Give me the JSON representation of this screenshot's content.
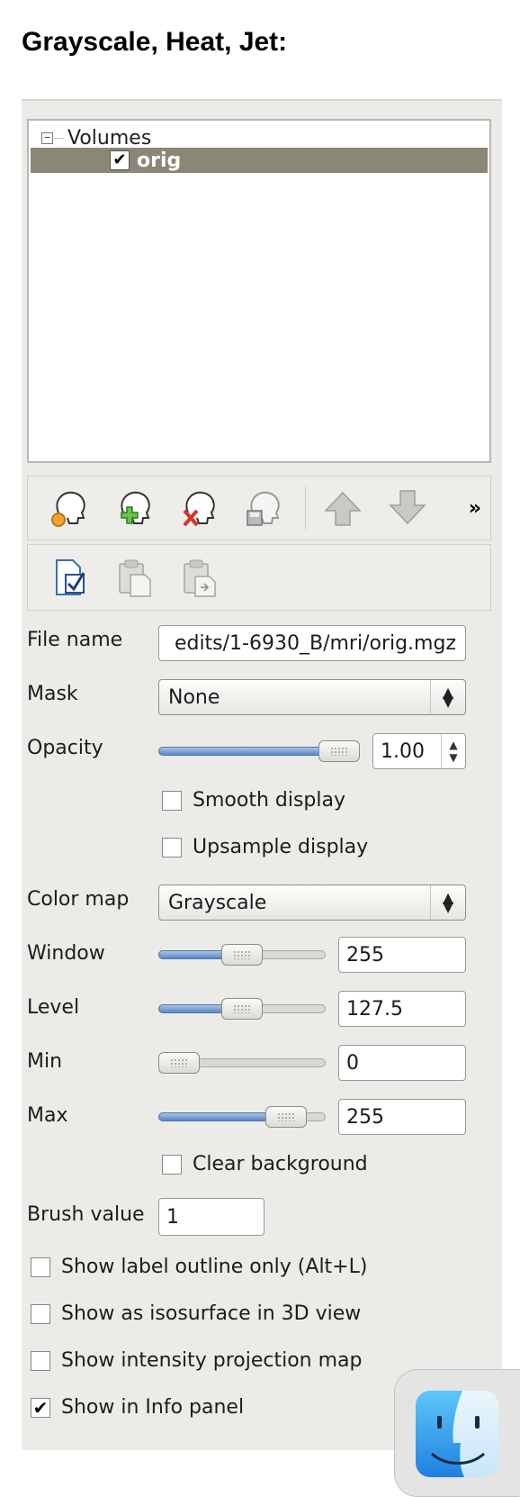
{
  "heading": "Grayscale, Heat, Jet:",
  "tree": {
    "root_label": "Volumes",
    "expander": "−",
    "items": [
      {
        "label": "orig",
        "checked": true
      }
    ]
  },
  "toolbar": {
    "row1": [
      "load-volume-icon",
      "new-volume-icon",
      "close-volume-icon",
      "save-volume-icon",
      "move-up-icon",
      "move-down-icon"
    ],
    "overflow_label": "»",
    "row2": [
      "select-all-icon",
      "copy-settings-icon",
      "paste-settings-icon"
    ]
  },
  "file_name": {
    "label": "File name",
    "value": "edits/1-6930_B/mri/orig.mgz"
  },
  "mask": {
    "label": "Mask",
    "value": "None"
  },
  "opacity": {
    "label": "Opacity",
    "value": "1.00",
    "fraction": 1.0
  },
  "smooth_display": {
    "label": "Smooth display",
    "checked": false
  },
  "upsample_display": {
    "label": "Upsample display",
    "checked": false
  },
  "color_map": {
    "label": "Color map",
    "value": "Grayscale"
  },
  "window": {
    "label": "Window",
    "value": "255",
    "fraction": 0.5
  },
  "level": {
    "label": "Level",
    "value": "127.5",
    "fraction": 0.5
  },
  "min": {
    "label": "Min",
    "value": "0",
    "fraction": 0.0
  },
  "max": {
    "label": "Max",
    "value": "255",
    "fraction": 0.85
  },
  "clear_background": {
    "label": "Clear background",
    "checked": false
  },
  "brush_value": {
    "label": "Brush value",
    "value": "1"
  },
  "options": [
    {
      "label": "Show label outline only (Alt+L)",
      "checked": false
    },
    {
      "label": "Show as isosurface in 3D view",
      "checked": false
    },
    {
      "label": "Show intensity projection map",
      "checked": false
    },
    {
      "label": "Show in Info panel",
      "checked": true
    }
  ],
  "checkmark": "✔",
  "colors": {
    "selection": "#8b8776",
    "slider_fill": "#5b86c4",
    "panel_bg": "#ecebe8"
  }
}
